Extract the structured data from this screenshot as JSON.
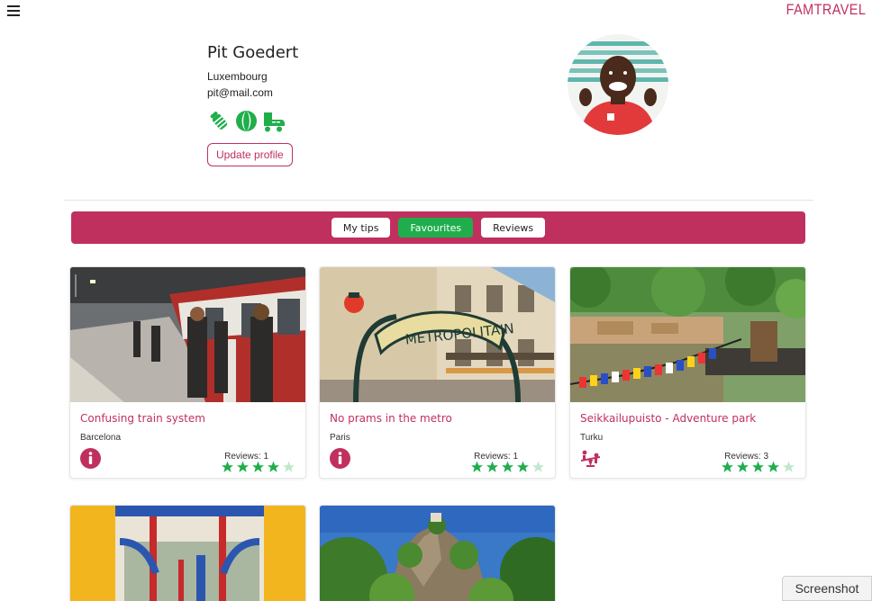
{
  "header": {
    "logo": "FAMTRAVEL",
    "menu_icon": "hamburger-icon"
  },
  "profile": {
    "name": "Pit Goedert",
    "country": "Luxembourg",
    "email": "pit@mail.com",
    "interests": [
      "baby-bottle-icon",
      "beach-ball-icon",
      "roller-skate-icon"
    ],
    "update_label": "Update profile",
    "accent": "#c0305e",
    "interest_color": "#1fae4b"
  },
  "tabs": [
    {
      "label": "My tips",
      "active": false
    },
    {
      "label": "Favourites",
      "active": true
    },
    {
      "label": "Reviews",
      "active": false
    }
  ],
  "cards": [
    {
      "title": "Confusing train system",
      "location": "Barcelona",
      "reviews": "Reviews: 1",
      "rating": 4,
      "category_icon": "info-icon"
    },
    {
      "title": "No prams in the metro",
      "location": "Paris",
      "reviews": "Reviews: 1",
      "rating": 4,
      "category_icon": "info-icon"
    },
    {
      "title": "Seikkailupuisto - Adventure park",
      "location": "Turku",
      "reviews": "Reviews: 3",
      "rating": 4,
      "category_icon": "seesaw-icon"
    }
  ],
  "screenshot_label": "Screenshot"
}
